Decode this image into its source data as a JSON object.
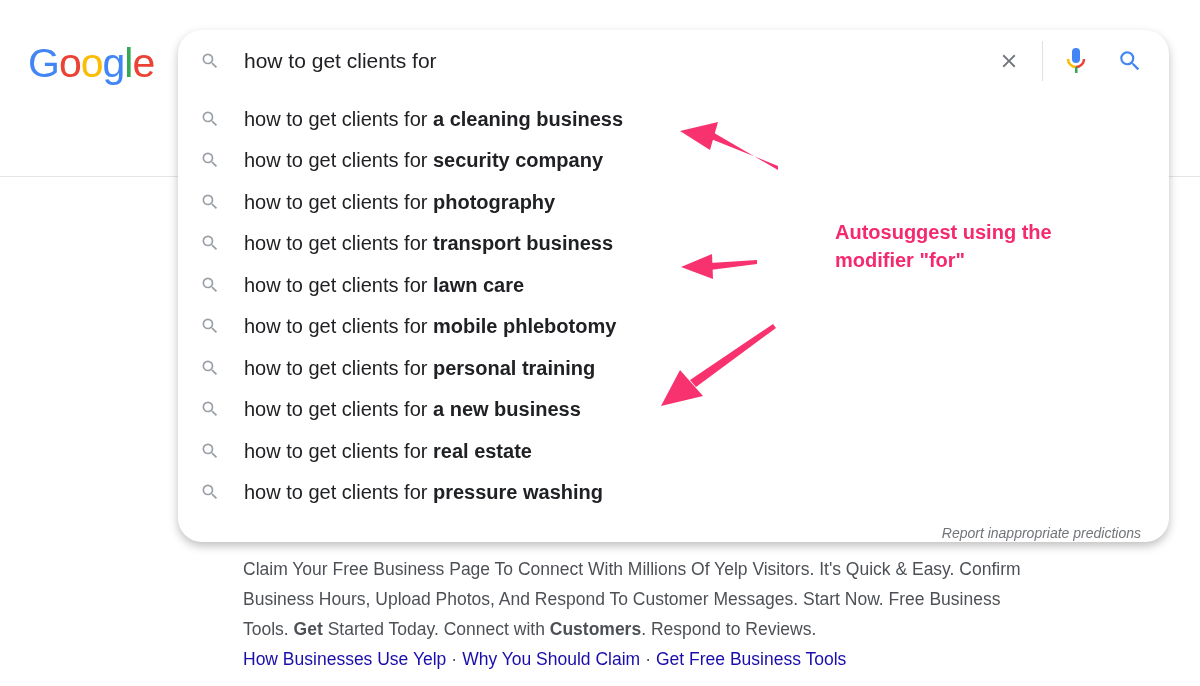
{
  "logo": {
    "text": "Google"
  },
  "search": {
    "value": "how to get clients for"
  },
  "suggestions": [
    {
      "text": "how to get clients for **a cleaning business**"
    },
    {
      "text": "how to get clients for **security company**"
    },
    {
      "text": "how to get clients for **photography**"
    },
    {
      "text": "how to get clients for **transport business**"
    },
    {
      "text": "how to get clients for **lawn care**"
    },
    {
      "text": "how to get clients for **mobile phlebotomy**"
    },
    {
      "text": "how to get clients for **personal training**"
    },
    {
      "text": "how to get clients for **a new business**"
    },
    {
      "text": "how to get clients for **real estate**"
    },
    {
      "text": "how to get clients for **pressure washing**"
    }
  ],
  "report_link": "Report inappropriate predictions",
  "result": {
    "snippet": "Claim Your Free Business Page To Connect With Millions Of Yelp Visitors. It's Quick & Easy. Confirm Business Hours, Upload Photos, And Respond To Customer Messages. Start Now. Free Business Tools. **Get** Started Today. Connect with **Customers**. Respond to Reviews.",
    "sitelinks": [
      {
        "kind": "link",
        "text": "How Businesses Use Yelp"
      },
      {
        "kind": "separator",
        "text": "·"
      },
      {
        "kind": "link",
        "text": "Why You Should Claim"
      },
      {
        "kind": "separator",
        "text": "·"
      },
      {
        "kind": "link",
        "text": "Get Free Business Tools"
      }
    ]
  },
  "annotation": {
    "text": "Autosuggest using the modifier \"for\""
  }
}
